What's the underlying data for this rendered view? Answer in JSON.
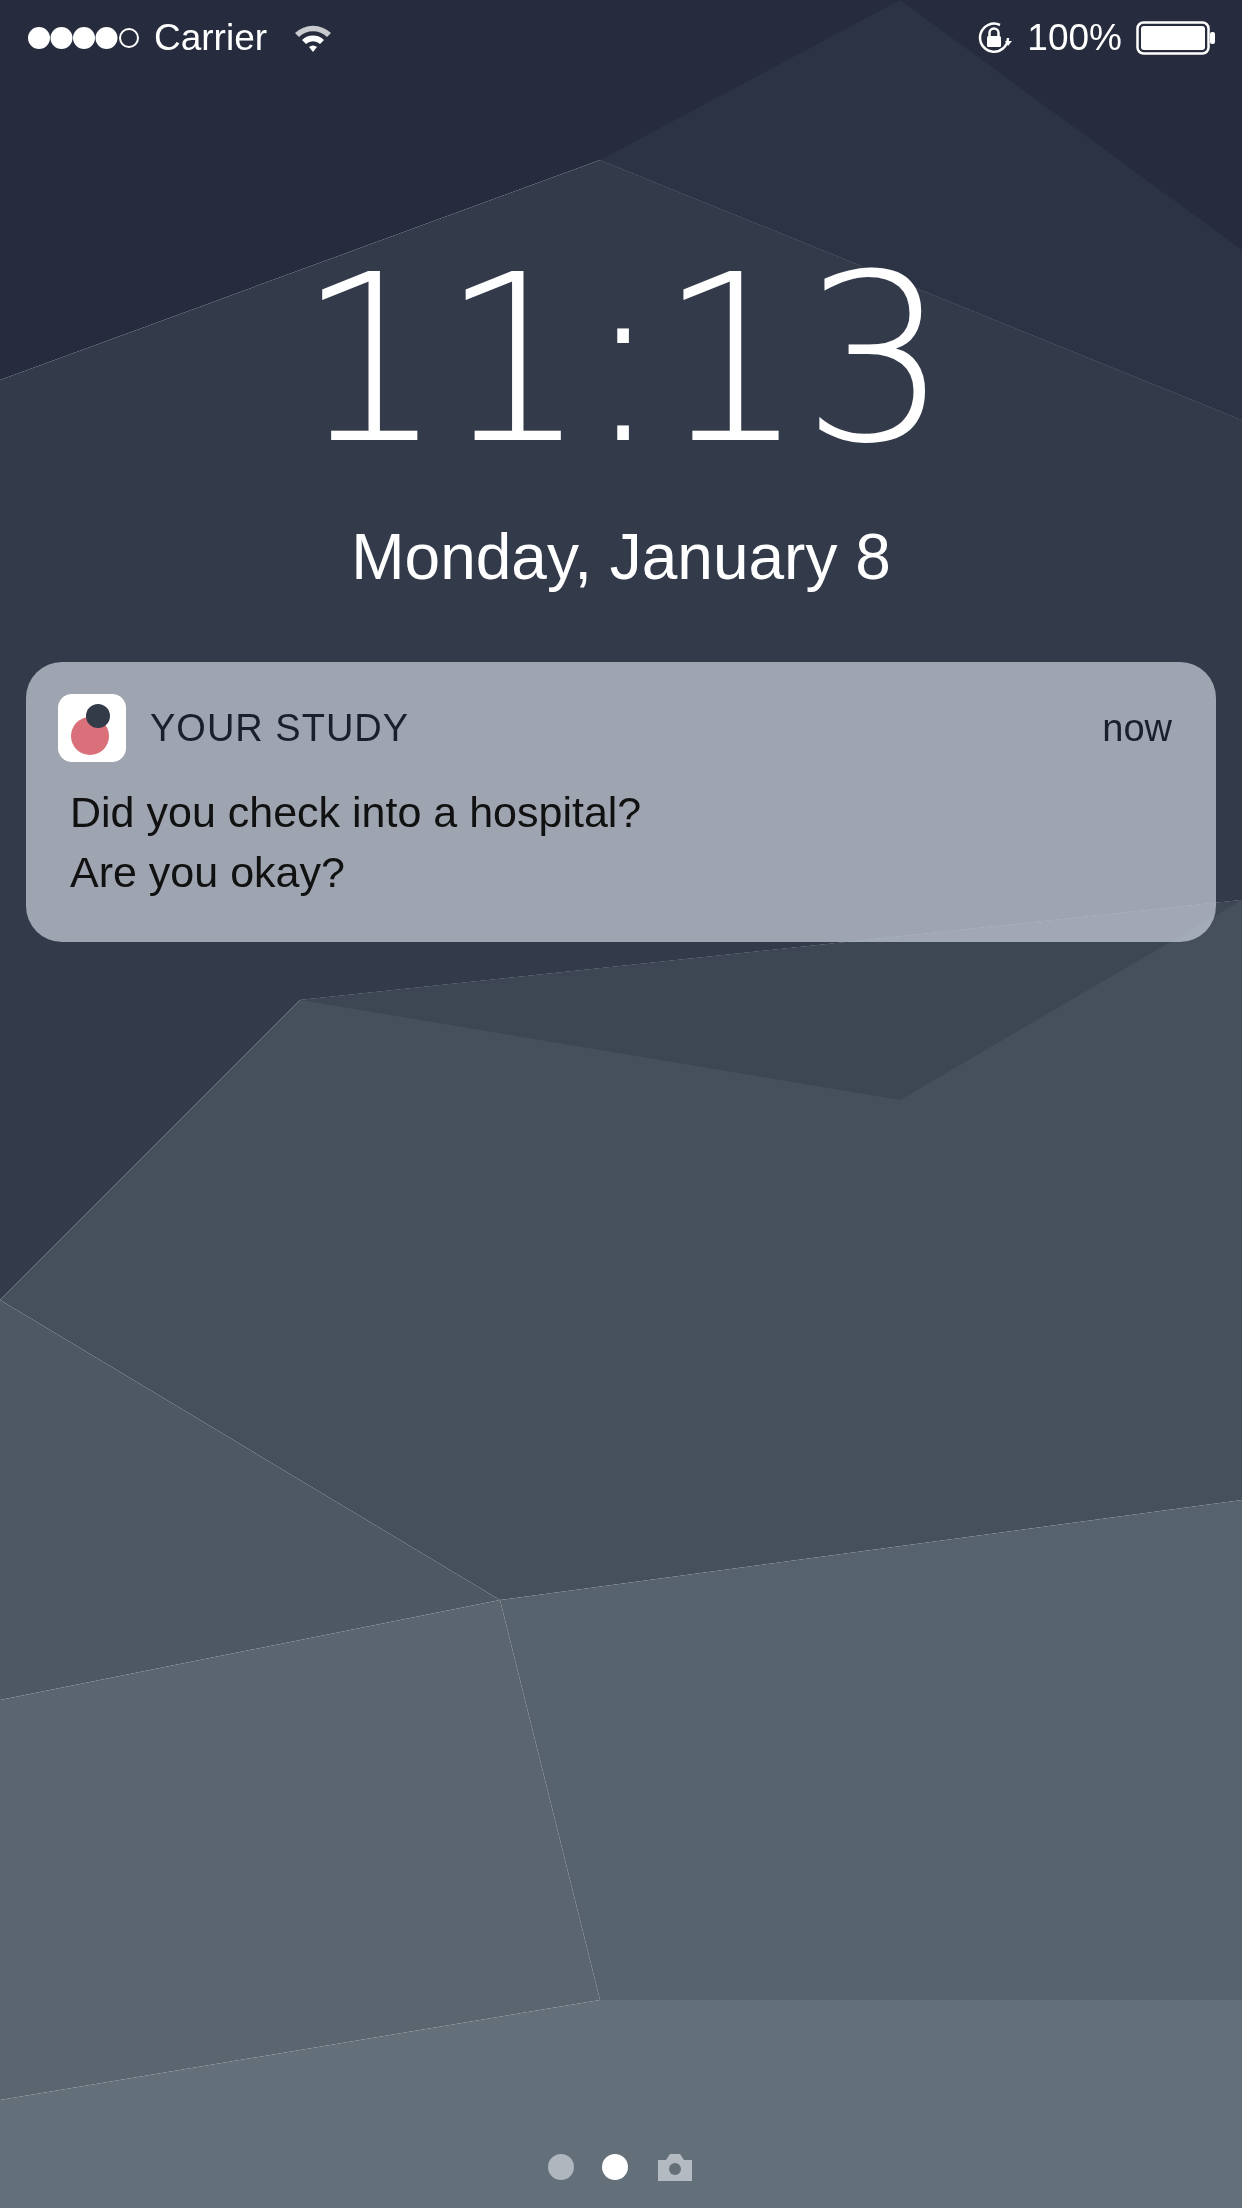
{
  "status_bar": {
    "carrier": "Carrier",
    "battery": "100%"
  },
  "clock": {
    "time": "11:13",
    "date": "Monday, January 8"
  },
  "notification": {
    "app": "YOUR STUDY",
    "time": "now",
    "message": "Did you check into a hospital?\nAre you okay?"
  },
  "page_indicator": [
    {
      "kind": "dot",
      "selected": false
    },
    {
      "kind": "dot",
      "selected": true
    },
    {
      "kind": "camera",
      "selected": false
    }
  ]
}
